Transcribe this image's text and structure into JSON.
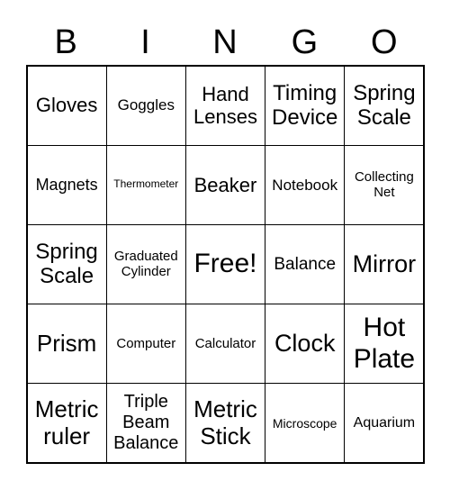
{
  "header": [
    "B",
    "I",
    "N",
    "G",
    "O"
  ],
  "cells": [
    "Gloves",
    "Goggles",
    "Hand Lenses",
    "Timing Device",
    "Spring Scale",
    "Magnets",
    "Thermometer",
    "Beaker",
    "Notebook",
    "Collecting Net",
    "Spring Scale",
    "Graduated Cylinder",
    "Free!",
    "Balance",
    "Mirror",
    "Prism",
    "Computer",
    "Calculator",
    "Clock",
    "Hot Plate",
    "Metric ruler",
    "Triple Beam Balance",
    "Metric Stick",
    "Microscope",
    "Aquarium"
  ]
}
